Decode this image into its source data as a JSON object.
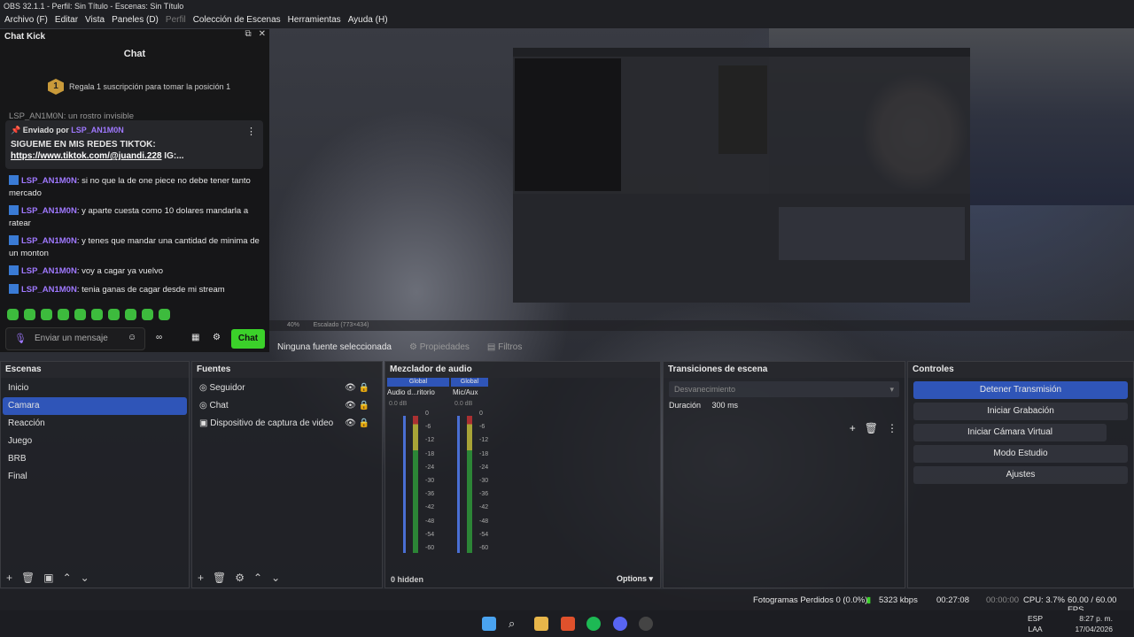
{
  "window": {
    "title": "OBS 32.1.1 - Perfil: Sin Título - Escenas: Sin Título"
  },
  "menu": [
    "Archivo (F)",
    "Editar",
    "Vista",
    "Paneles (D)",
    "Perfil",
    "Colección de Escenas",
    "Herramientas",
    "Ayuda (H)"
  ],
  "chat_dock": {
    "title": "Chat Kick",
    "header": "Chat",
    "gift_text": "Regala 1 suscripción para tomar la posición 1",
    "gift_rank": "1",
    "pinned_by_label": "Enviado por",
    "pinned_user": "LSP_AN1M0N",
    "pinned_line1": "SIGUEME EN MIS REDES TIKTOK:",
    "pinned_link": "https://www.tiktok.com/@juandi.228",
    "pinned_tail": " IG:...",
    "partial_message": "LSP_AN1M0N: un rostro invisible",
    "messages": [
      {
        "user": "LSP_AN1M0N",
        "text": ": si no que la de one piece no debe tener tanto mercado"
      },
      {
        "user": "LSP_AN1M0N",
        "text": ": y aparte cuesta como 10 dolares mandarla a ratear"
      },
      {
        "user": "LSP_AN1M0N",
        "text": ": y tenes que mandar una cantidad de minima de un monton"
      },
      {
        "user": "LSP_AN1M0N",
        "text": ": voy a cagar ya vuelvo"
      },
      {
        "user": "LSP_AN1M0N",
        "text": ": tenia ganas de cagar desde mi stream"
      }
    ],
    "input_placeholder": "Enviar un mensaje",
    "send_label": "Chat"
  },
  "preview_bar": {
    "zoom": "40%",
    "scale": "Escalado (773×434)"
  },
  "source_bar": {
    "none_selected": "Ninguna fuente seleccionada",
    "properties": "Propiedades",
    "filters": "Filtros"
  },
  "scenes": {
    "title": "Escenas",
    "items": [
      "Inicio",
      "Camara",
      "Reacción",
      "Juego",
      "BRB",
      "Final"
    ],
    "selected": 1
  },
  "sources": {
    "title": "Fuentes",
    "items": [
      "Seguidor",
      "Chat",
      "Dispositivo de captura de video"
    ]
  },
  "mixer": {
    "title": "Mezclador de audio",
    "channels": [
      {
        "name": "Audio d...ritorio",
        "tag": "Global",
        "db": "0.0 dB"
      },
      {
        "name": "Mic/Aux",
        "tag": "Global",
        "db": "0.0 dB"
      }
    ],
    "scale": [
      "0",
      "-6",
      "-12",
      "-18",
      "-24",
      "-30",
      "-36",
      "-42",
      "-48",
      "-54",
      "-60"
    ],
    "hidden": "0 hidden",
    "options": "Options"
  },
  "transitions": {
    "title": "Transiciones de escena",
    "selected": "Desvanecimiento",
    "duration_label": "Duración",
    "duration": "300 ms"
  },
  "controls": {
    "title": "Controles",
    "buttons": [
      "Detener Transmisión",
      "Iniciar Grabación",
      "Iniciar Cámara Virtual",
      "Modo Estudio",
      "Ajustes"
    ]
  },
  "status": {
    "dropped": "Fotogramas Perdidos 0 (0.0%)",
    "bitrate": "5323 kbps",
    "stream_time": "00:27:08",
    "rec_time": "00:00:00",
    "cpu": "CPU: 3.7%",
    "fps": "60.00 / 60.00 FPS"
  },
  "taskbar": {
    "lang": "ESP",
    "lang2": "LAA",
    "time": "8:27 p. m.",
    "date": "17/04/2026"
  },
  "colors": {
    "accent": "#2f55b8",
    "kick_green": "#3bd12a",
    "username": "#9f78ff"
  }
}
